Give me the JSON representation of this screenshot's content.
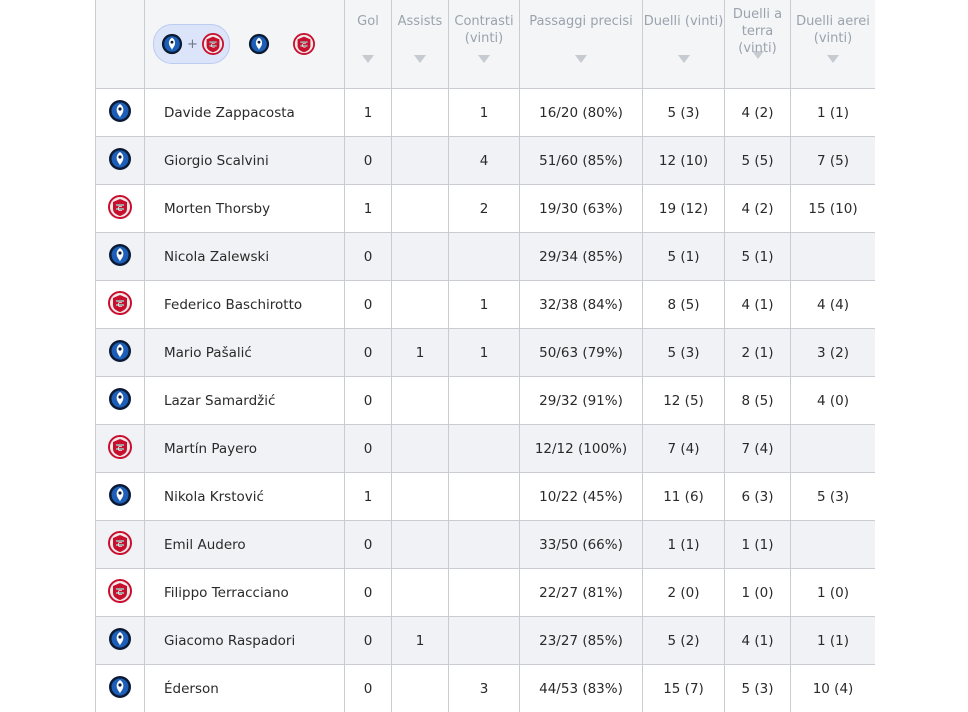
{
  "filters": [
    {
      "id": "both",
      "plus": "+",
      "active": true
    },
    {
      "id": "atalanta",
      "active": false
    },
    {
      "id": "cremonese",
      "active": false
    }
  ],
  "teams": {
    "atalanta": {
      "icon": "atalanta-crest-icon",
      "primary": "#1d5fb8",
      "secondary": "#0b1a33"
    },
    "cremonese": {
      "icon": "cremonese-crest-icon",
      "primary": "#c8102e",
      "secondary": "#a0a0a0"
    }
  },
  "columns": [
    {
      "label": "Gol"
    },
    {
      "label": "Assists"
    },
    {
      "label": "Contrasti (vinti)"
    },
    {
      "label": "Passaggi precisi"
    },
    {
      "label": "Duelli (vinti)"
    },
    {
      "label": "Duelli a terra (vinti)"
    },
    {
      "label": "Duelli aerei (vinti)"
    }
  ],
  "rows": [
    {
      "team": "atalanta",
      "name": "Davide Zappacosta",
      "gol": "1",
      "assists": "",
      "contrasti": "1",
      "passaggi": "16/20 (80%)",
      "duelli": "5 (3)",
      "terra": "4 (2)",
      "aerei": "1 (1)"
    },
    {
      "team": "atalanta",
      "name": "Giorgio Scalvini",
      "gol": "0",
      "assists": "",
      "contrasti": "4",
      "passaggi": "51/60 (85%)",
      "duelli": "12 (10)",
      "terra": "5 (5)",
      "aerei": "7 (5)"
    },
    {
      "team": "cremonese",
      "name": "Morten Thorsby",
      "gol": "1",
      "assists": "",
      "contrasti": "2",
      "passaggi": "19/30 (63%)",
      "duelli": "19 (12)",
      "terra": "4 (2)",
      "aerei": "15 (10)"
    },
    {
      "team": "atalanta",
      "name": "Nicola Zalewski",
      "gol": "0",
      "assists": "",
      "contrasti": "",
      "passaggi": "29/34 (85%)",
      "duelli": "5 (1)",
      "terra": "5 (1)",
      "aerei": ""
    },
    {
      "team": "cremonese",
      "name": "Federico Baschirotto",
      "gol": "0",
      "assists": "",
      "contrasti": "1",
      "passaggi": "32/38 (84%)",
      "duelli": "8 (5)",
      "terra": "4 (1)",
      "aerei": "4 (4)"
    },
    {
      "team": "atalanta",
      "name": "Mario Pašalić",
      "gol": "0",
      "assists": "1",
      "contrasti": "1",
      "passaggi": "50/63 (79%)",
      "duelli": "5 (3)",
      "terra": "2 (1)",
      "aerei": "3 (2)"
    },
    {
      "team": "atalanta",
      "name": "Lazar Samardžić",
      "gol": "0",
      "assists": "",
      "contrasti": "",
      "passaggi": "29/32 (91%)",
      "duelli": "12 (5)",
      "terra": "8 (5)",
      "aerei": "4 (0)"
    },
    {
      "team": "cremonese",
      "name": "Martín Payero",
      "gol": "0",
      "assists": "",
      "contrasti": "",
      "passaggi": "12/12 (100%)",
      "duelli": "7 (4)",
      "terra": "7 (4)",
      "aerei": ""
    },
    {
      "team": "atalanta",
      "name": "Nikola Krstović",
      "gol": "1",
      "assists": "",
      "contrasti": "",
      "passaggi": "10/22 (45%)",
      "duelli": "11 (6)",
      "terra": "6 (3)",
      "aerei": "5 (3)"
    },
    {
      "team": "cremonese",
      "name": "Emil Audero",
      "gol": "0",
      "assists": "",
      "contrasti": "",
      "passaggi": "33/50 (66%)",
      "duelli": "1 (1)",
      "terra": "1 (1)",
      "aerei": ""
    },
    {
      "team": "cremonese",
      "name": "Filippo Terracciano",
      "gol": "0",
      "assists": "",
      "contrasti": "",
      "passaggi": "22/27 (81%)",
      "duelli": "2 (0)",
      "terra": "1 (0)",
      "aerei": "1 (0)"
    },
    {
      "team": "atalanta",
      "name": "Giacomo Raspadori",
      "gol": "0",
      "assists": "1",
      "contrasti": "",
      "passaggi": "23/27 (85%)",
      "duelli": "5 (2)",
      "terra": "4 (1)",
      "aerei": "1 (1)"
    },
    {
      "team": "atalanta",
      "name": "Éderson",
      "gol": "0",
      "assists": "",
      "contrasti": "3",
      "passaggi": "44/53 (83%)",
      "duelli": "15 (7)",
      "terra": "5 (3)",
      "aerei": "10 (4)"
    }
  ]
}
